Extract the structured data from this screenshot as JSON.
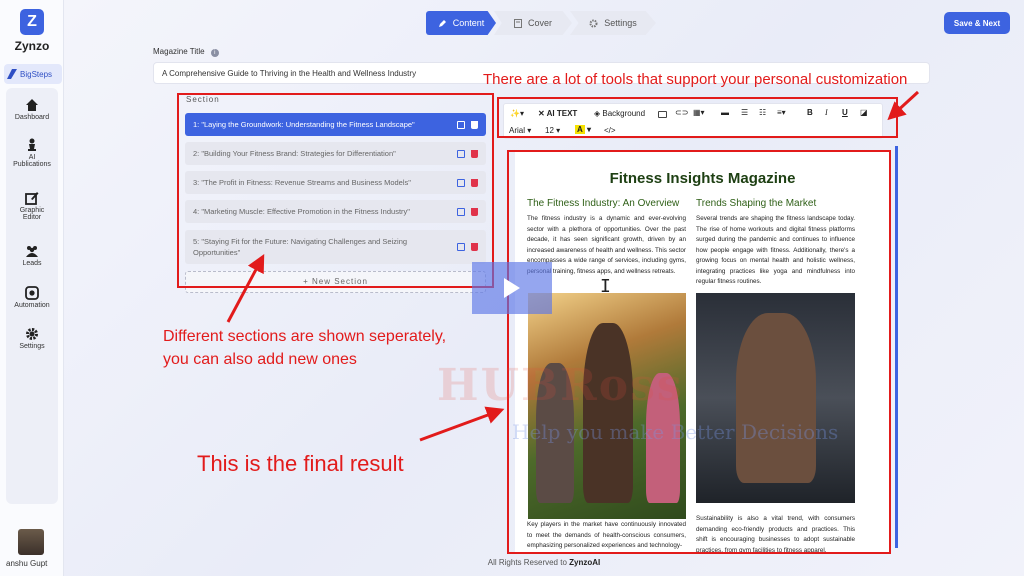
{
  "app": {
    "logo_letter": "Z",
    "name": "Zynzo",
    "workspace": "BigSteps"
  },
  "sidebar": {
    "items": [
      {
        "label": "Dashboard"
      },
      {
        "label": "AI Publications"
      },
      {
        "label": "Graphic Editor"
      },
      {
        "label": "Leads"
      },
      {
        "label": "Automation"
      },
      {
        "label": "Settings"
      }
    ],
    "user_name": "anshu Gupt"
  },
  "steps": [
    {
      "label": "Content",
      "active": true
    },
    {
      "label": "Cover",
      "active": false
    },
    {
      "label": "Settings",
      "active": false
    }
  ],
  "header": {
    "save_label": "Save & Next"
  },
  "magazine": {
    "title_label": "Magazine Title",
    "title_value": "A Comprehensive Guide to Thriving in the Health and Wellness Industry"
  },
  "sections": {
    "label": "Section",
    "items": [
      "1: \"Laying the Groundwork: Understanding the Fitness Landscape\"",
      "2: \"Building Your Fitness Brand: Strategies for Differentiation\"",
      "3: \"The Profit in Fitness: Revenue Streams and Business Models\"",
      "4: \"Marketing Muscle: Effective Promotion in the Fitness Industry\"",
      "5: \"Staying Fit for the Future: Navigating Challenges and Seizing Opportunities\""
    ],
    "new_label": "+ New Section"
  },
  "toolbar": {
    "ai_text": "AI TEXT",
    "background": "Background",
    "font": "Arial",
    "size": "12",
    "bold": "B",
    "italic": "I",
    "underline": "U",
    "code": "</>"
  },
  "document": {
    "title": "Fitness Insights Magazine",
    "col1_heading": "The Fitness Industry: An Overview",
    "col1_text": "The fitness industry is a dynamic and ever-evolving sector with a plethora of opportunities. Over the past decade, it has seen significant growth, driven by an increased awareness of health and wellness. This sector encompasses a wide range of services, including gyms, personal training, fitness apps, and wellness retreats.",
    "col1_bottom": "Key players in the market have continuously innovated to meet the demands of health-conscious consumers, emphasizing personalized experiences and technology-",
    "col2_heading": "Trends Shaping the Market",
    "col2_text": "Several trends are shaping the fitness landscape today. The rise of home workouts and digital fitness platforms surged during the pandemic and continues to influence how people engage with fitness. Additionally, there's a growing focus on mental health and holistic wellness, integrating practices like yoga and mindfulness into regular fitness routines.",
    "col2_bottom": "Sustainability is also a vital trend, with consumers demanding eco-friendly products and practices. This shift is encouraging businesses to adopt sustainable practices, from gym facilities to fitness apparel."
  },
  "annotations": {
    "tools": "There are a lot of tools that support your personal customization",
    "sections_line1": "Different sections are shown seperately,",
    "sections_line2": "you can also add new ones",
    "final": "This is the final result",
    "watermark": "HUBRoss",
    "watermark_sub": "Help you make Better Decisions"
  },
  "footer": {
    "prefix": "All Rights Reserved to",
    "brand": "ZynzoAI"
  },
  "colors": {
    "accent": "#3d63e0",
    "annotation": "#e21b1b",
    "delete": "#e0334a",
    "doc_title": "#1d3f12",
    "doc_heading": "#2e5f16"
  }
}
